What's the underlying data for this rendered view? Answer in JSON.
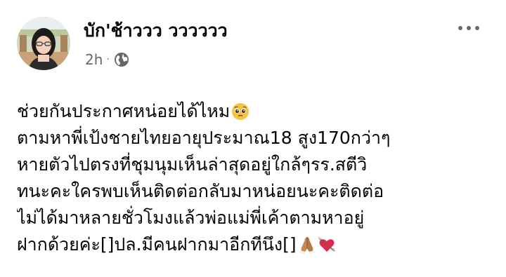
{
  "post": {
    "author": "บัก'ช้าววว วววววว",
    "timestamp": "2h",
    "separator": "·",
    "privacy_icon": "globe-icon",
    "more_icon": "more-horizontal-icon",
    "lines": [
      "ช่วยกันประกาศหน่อยได้ไหม",
      "ตามหาพี่เป้งชายไทยอายุประมาณ18 สูง170กว่าๆ",
      "หายตัวไปตรงที่ชุมนุมเห็นล่าสุดอยู่ใกล้ๆรร.สตีวิ",
      "ทนะคะใครพบเห็นติดต่อกลับมาหน่อยนะคะติดต่อ",
      "ไม่ได้มาหลายชั่วโมงแล้วพ่อแม่พี่เค้าตามหาอยู่",
      "ฝากด้วยค่ะ[]ปล.มีคนฝากมาอีกทีนึง[]"
    ],
    "emoji": {
      "line1_end": "pleading-face-icon",
      "line6_end_1": "folded-hands-icon",
      "line6_end_2": "heart-with-arrow-icon"
    }
  },
  "colors": {
    "text": "#050505",
    "secondary_text": "#65676b"
  }
}
